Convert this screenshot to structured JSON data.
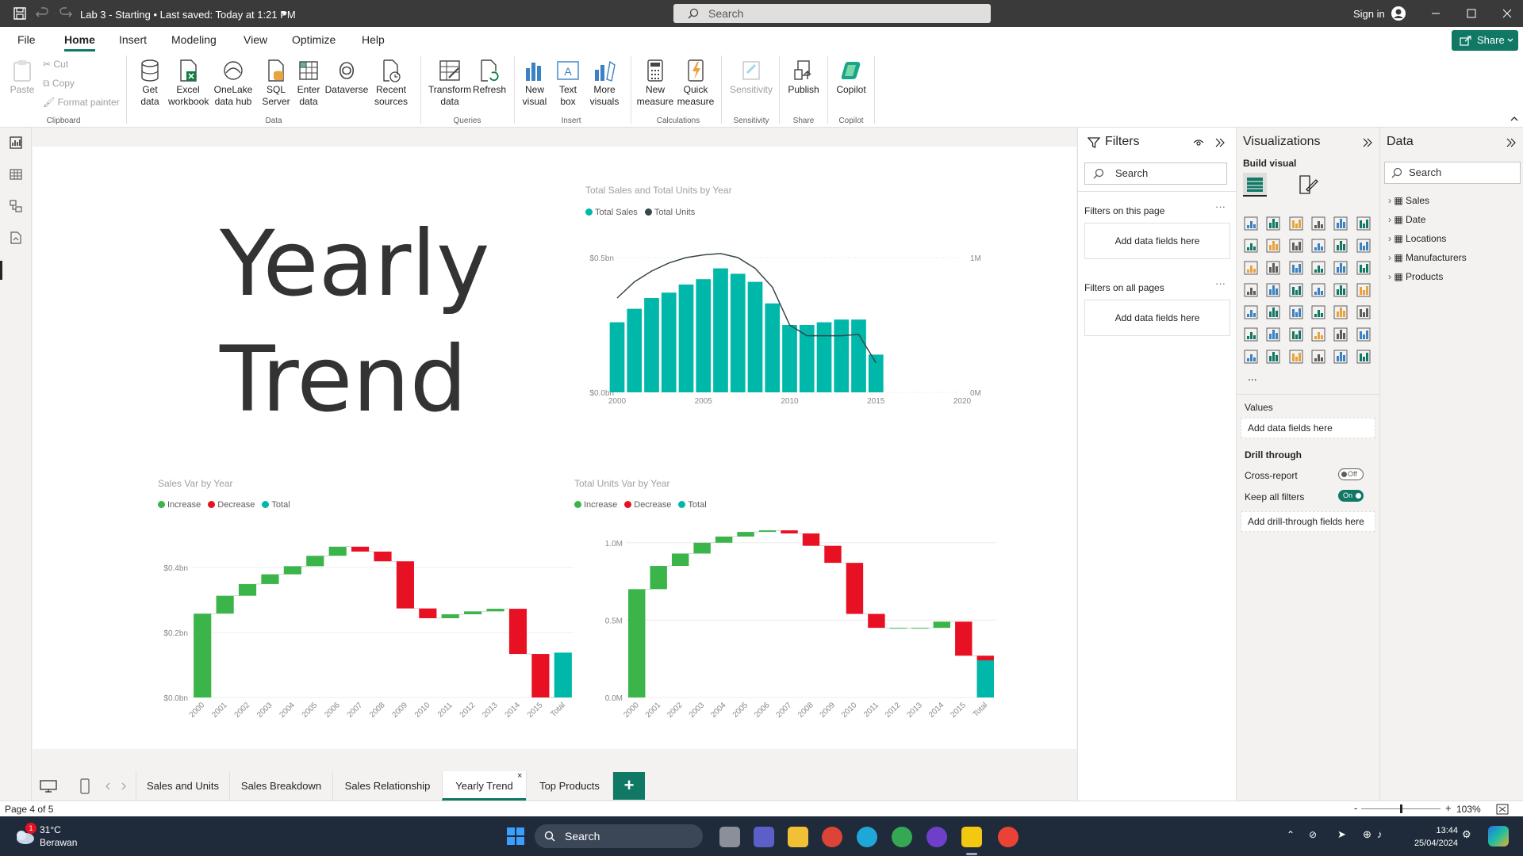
{
  "titlebar": {
    "doc_title": "Lab 3 - Starting • Last saved: Today at 1:21 PM",
    "search_placeholder": "Search",
    "signin": "Sign in"
  },
  "menu": {
    "file": "File",
    "home": "Home",
    "insert": "Insert",
    "modeling": "Modeling",
    "view": "View",
    "optimize": "Optimize",
    "help": "Help",
    "share": "Share"
  },
  "ribbon": {
    "paste": "Paste",
    "cut": "Cut",
    "copy": "Copy",
    "format_painter": "Format painter",
    "clipboard": "Clipboard",
    "get_data_1": "Get",
    "get_data_2": "data",
    "excel_1": "Excel",
    "excel_2": "workbook",
    "onelake_1": "OneLake",
    "onelake_2": "data hub",
    "sql_1": "SQL",
    "sql_2": "Server",
    "enter_1": "Enter",
    "enter_2": "data",
    "dataverse": "Dataverse",
    "recent_1": "Recent",
    "recent_2": "sources",
    "data_group": "Data",
    "transform_1": "Transform",
    "transform_2": "data",
    "refresh": "Refresh",
    "queries_group": "Queries",
    "newvisual_1": "New",
    "newvisual_2": "visual",
    "textbox_1": "Text",
    "textbox_2": "box",
    "morevis_1": "More",
    "morevis_2": "visuals",
    "insert_group": "Insert",
    "newmeasure_1": "New",
    "newmeasure_2": "measure",
    "quickmeasure_1": "Quick",
    "quickmeasure_2": "measure",
    "calc_group": "Calculations",
    "sensitivity": "Sensitivity",
    "sensitivity_group": "Sensitivity",
    "publish": "Publish",
    "share_group": "Share",
    "copilot": "Copilot",
    "copilot_group": "Copilot"
  },
  "report": {
    "big_title_line1": "Yearly",
    "big_title_line2": "Trend"
  },
  "colors": {
    "teal": "#00b8aa",
    "dark": "#374649",
    "increase": "#3bb44a",
    "decrease": "#e81123",
    "accent": "#117865"
  },
  "chart_data": [
    {
      "type": "bar",
      "title": "Total Sales and Total Units by Year",
      "legend": [
        "Total Sales",
        "Total Units"
      ],
      "x": [
        2000,
        2001,
        2002,
        2003,
        2004,
        2005,
        2006,
        2007,
        2008,
        2009,
        2010,
        2011,
        2012,
        2013,
        2014,
        2015
      ],
      "series": [
        {
          "name": "Total Sales",
          "axis": "left",
          "values": [
            0.26,
            0.31,
            0.35,
            0.37,
            0.4,
            0.42,
            0.46,
            0.44,
            0.41,
            0.33,
            0.25,
            0.25,
            0.26,
            0.27,
            0.27,
            0.14
          ]
        },
        {
          "name": "Total Units",
          "axis": "right",
          "values": [
            0.7,
            0.82,
            0.9,
            0.96,
            1.0,
            1.02,
            1.03,
            1.0,
            0.92,
            0.78,
            0.5,
            0.42,
            0.42,
            0.42,
            0.43,
            0.22
          ]
        }
      ],
      "xlim": [
        2000,
        2020
      ],
      "x_ticks": [
        "2000",
        "2005",
        "2010",
        "2015",
        "2020"
      ],
      "ylim_left": [
        0,
        0.5
      ],
      "y_ticks_left": [
        "$0.0bn",
        "$0.5bn"
      ],
      "ylim_right": [
        0,
        1
      ],
      "y_ticks_right": [
        "0M",
        "1M"
      ],
      "legend_position": "top-left"
    },
    {
      "type": "waterfall",
      "title": "Sales Var by Year",
      "legend": [
        "Increase",
        "Decrease",
        "Total"
      ],
      "categories": [
        "2000",
        "2001",
        "2002",
        "2003",
        "2004",
        "2005",
        "2006",
        "2007",
        "2008",
        "2009",
        "2010",
        "2011",
        "2012",
        "2013",
        "2014",
        "2015",
        "Total"
      ],
      "deltas": [
        0.258,
        0.055,
        0.036,
        0.03,
        0.025,
        0.032,
        0.028,
        -0.015,
        -0.03,
        -0.145,
        -0.03,
        0.012,
        0.009,
        0.008,
        -0.139,
        -0.134
      ],
      "total": 0.138,
      "ylim": [
        0,
        0.5
      ],
      "y_ticks": [
        "$0.0bn",
        "$0.2bn",
        "$0.4bn"
      ],
      "legend_position": "top-left"
    },
    {
      "type": "waterfall",
      "title": "Total Units Var by Year",
      "legend": [
        "Increase",
        "Decrease",
        "Total"
      ],
      "categories": [
        "2000",
        "2001",
        "2002",
        "2003",
        "2004",
        "2005",
        "2006",
        "2007",
        "2008",
        "2009",
        "2010",
        "2011",
        "2012",
        "2013",
        "2014",
        "2015",
        "Total"
      ],
      "deltas": [
        0.7,
        0.15,
        0.08,
        0.07,
        0.04,
        0.03,
        0.01,
        -0.02,
        -0.08,
        -0.11,
        -0.33,
        -0.09,
        0.0,
        0.0,
        0.04,
        -0.22,
        -0.24
      ],
      "total": 0.24,
      "ylim": [
        0,
        1.05
      ],
      "y_ticks": [
        "0.0M",
        "0.5M",
        "1.0M"
      ],
      "legend_position": "top-left"
    }
  ],
  "tabs": [
    "Sales and Units",
    "Sales Breakdown",
    "Sales Relationship",
    "Yearly Trend",
    "Top Products"
  ],
  "active_tab": "Yearly Trend",
  "status": {
    "page_info": "Page 4 of 5",
    "zoom": "103%"
  },
  "filters": {
    "title": "Filters",
    "search": "Search",
    "on_this_page": "Filters on this page",
    "on_all_pages": "Filters on all pages",
    "add_fields": "Add data fields here"
  },
  "viz": {
    "title": "Visualizations",
    "build_visual": "Build visual",
    "values": "Values",
    "add_fields": "Add data fields here",
    "drill_through": "Drill through",
    "cross_report": "Cross-report",
    "cross_report_state": "Off",
    "keep_filters": "Keep all filters",
    "keep_filters_state": "On",
    "add_drill": "Add drill-through fields here",
    "more": "..."
  },
  "data_pane": {
    "title": "Data",
    "search": "Search",
    "tables": [
      "Sales",
      "Date",
      "Locations",
      "Manufacturers",
      "Products"
    ]
  },
  "taskbar": {
    "temp": "31°C",
    "weather": "Berawan",
    "weather_badge": "1",
    "search": "Search",
    "time": "13:44",
    "date": "25/04/2024"
  }
}
